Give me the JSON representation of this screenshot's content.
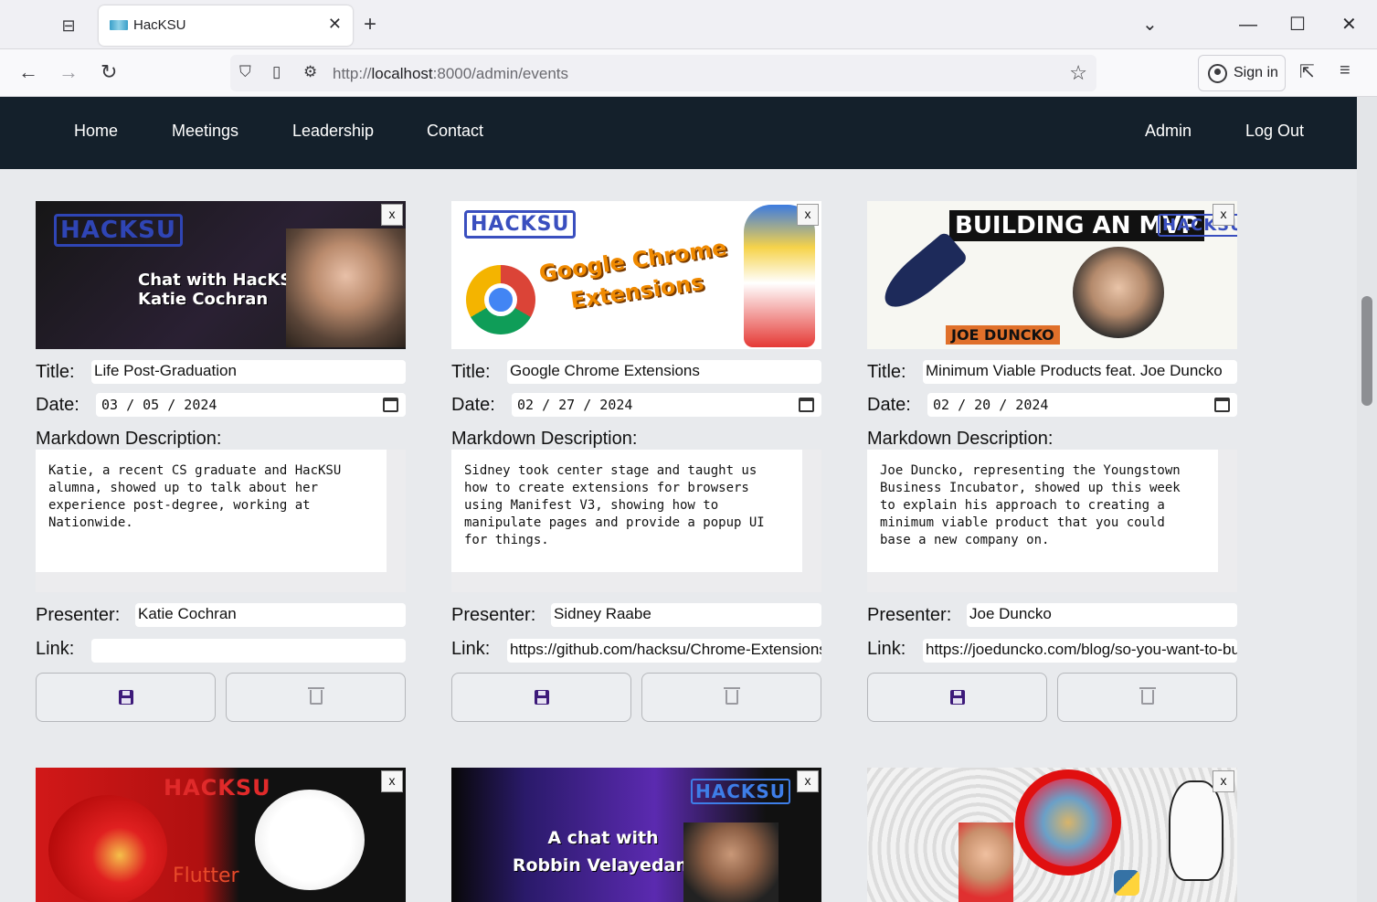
{
  "browser": {
    "tab_title": "HacKSU",
    "url_prefix": "http://",
    "url_host": "localhost",
    "url_rest": ":8000/admin/events",
    "sign_in": "Sign in"
  },
  "site_nav": {
    "left": [
      "Home",
      "Meetings",
      "Leadership",
      "Contact"
    ],
    "right": [
      "Admin",
      "Log Out"
    ]
  },
  "labels": {
    "title": "Title:",
    "date": "Date:",
    "markdown": "Markdown Description:",
    "presenter": "Presenter:",
    "link": "Link:",
    "close": "x"
  },
  "events": [
    {
      "image_text": "Chat with HacKSU alumnus: Katie Cochran",
      "title": "Life Post-Graduation",
      "date": "03 / 05 / 2024",
      "description": "Katie, a recent CS graduate and HacKSU\nalumna, showed up to talk about her\nexperience post-degree, working at\nNationwide.",
      "presenter": "Katie Cochran",
      "link": ""
    },
    {
      "image_text": "Google Chrome Extensions",
      "title": "Google Chrome Extensions",
      "date": "02 / 27 / 2024",
      "description": "Sidney took center stage and taught us\nhow to create extensions for browsers\nusing Manifest V3, showing how to\nmanipulate pages and provide a popup UI\nfor things.",
      "presenter": "Sidney Raabe",
      "link": "https://github.com/hacksu/Chrome-Extensions"
    },
    {
      "image_text": "BUILDING AN MVP",
      "image_subtext": "JOE DUNCKO",
      "title": "Minimum Viable Products feat. Joe Duncko",
      "date": "02 / 20 / 2024",
      "description": "Joe Duncko, representing the Youngstown\nBusiness Incubator, showed up this week\nto explain his approach to creating a\nminimum viable product that you could\nbase a new company on.",
      "presenter": "Joe Duncko",
      "link": "https://joeduncko.com/blog/so-you-want-to-build-an-mvp"
    }
  ],
  "next_row": [
    {
      "image_text": "Flutter"
    },
    {
      "image_text": "A chat with Robbin Velayedam"
    },
    {
      "image_text": "python"
    }
  ],
  "colors": {
    "site_header": "#14202b",
    "page_bg": "#e8eaed",
    "save_icon": "#3d1a7a"
  }
}
